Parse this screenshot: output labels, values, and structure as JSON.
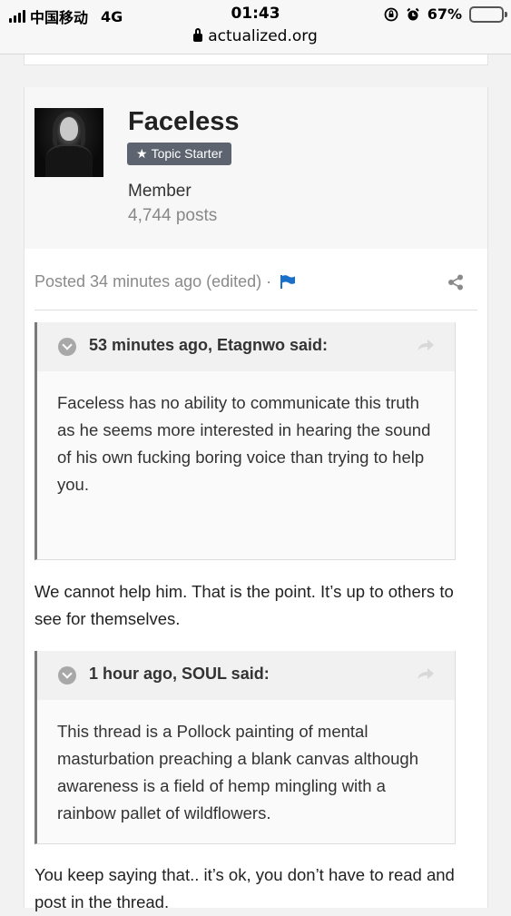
{
  "status_bar": {
    "carrier": "中国移动",
    "network": "4G",
    "time": "01:43",
    "battery": "67%",
    "battery_level": 0.67,
    "url": "actualized.org"
  },
  "post": {
    "author": {
      "name": "Faceless",
      "badge": "Topic Starter",
      "badge_icon": "star-icon",
      "rank": "Member",
      "posts": "4,744 posts"
    },
    "meta": {
      "posted": "Posted 34 minutes ago (edited)",
      "separator": "·",
      "report_icon": "flag-icon",
      "share_icon": "share-icon"
    },
    "quotes": [
      {
        "citation": "53 minutes ago, Etagnwo said:",
        "text": "Faceless has no ability to communicate this truth as he seems more interested in hearing the sound of his own fucking boring voice than trying to help you."
      },
      {
        "citation": "1 hour ago, SOUL said:",
        "text": "This thread is a Pollock painting of mental masturbation preaching a blank canvas although awareness is a field of hemp mingling with a rainbow pallet of wildflowers."
      }
    ],
    "replies": [
      "We cannot help him. That is the point. It’s up to others to see for themselves.",
      "You keep saying that.. it’s ok, you don’t have to read and post in the thread."
    ]
  },
  "colors": {
    "badge_bg": "#5d6470",
    "flag": "#1a6fc9",
    "battery": "#f5c400"
  }
}
